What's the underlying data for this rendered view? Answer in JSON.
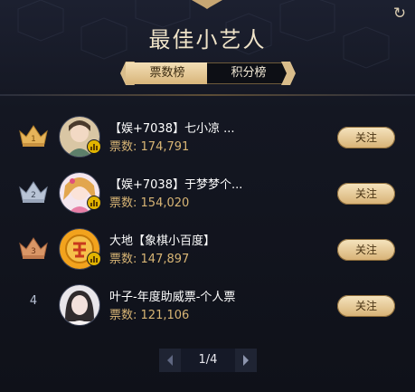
{
  "header": {
    "title": "最佳小艺人"
  },
  "tabs": [
    {
      "label": "票数榜",
      "active": true
    },
    {
      "label": "积分榜",
      "active": false
    }
  ],
  "rows": [
    {
      "rank": "1",
      "name": "【娱+7038】七小凉 ...",
      "votes_label": "票数:",
      "votes": "174,791",
      "follow_label": "关注"
    },
    {
      "rank": "2",
      "name": "【娱+7038】于梦梦个...",
      "votes_label": "票数:",
      "votes": "154,020",
      "follow_label": "关注"
    },
    {
      "rank": "3",
      "name": "大地【象棋小百度】",
      "votes_label": "票数:",
      "votes": "147,897",
      "follow_label": "关注"
    },
    {
      "rank": "4",
      "name": "叶子-年度助威票-个人票",
      "votes_label": "票数:",
      "votes": "121,106",
      "follow_label": "关注"
    }
  ],
  "pager": {
    "text": "1/4"
  },
  "colors": {
    "accent_gold": "#d8b575",
    "crown_gold": "#e6b45a",
    "crown_silver": "#b9c4d6",
    "crown_bronze": "#d99666"
  }
}
